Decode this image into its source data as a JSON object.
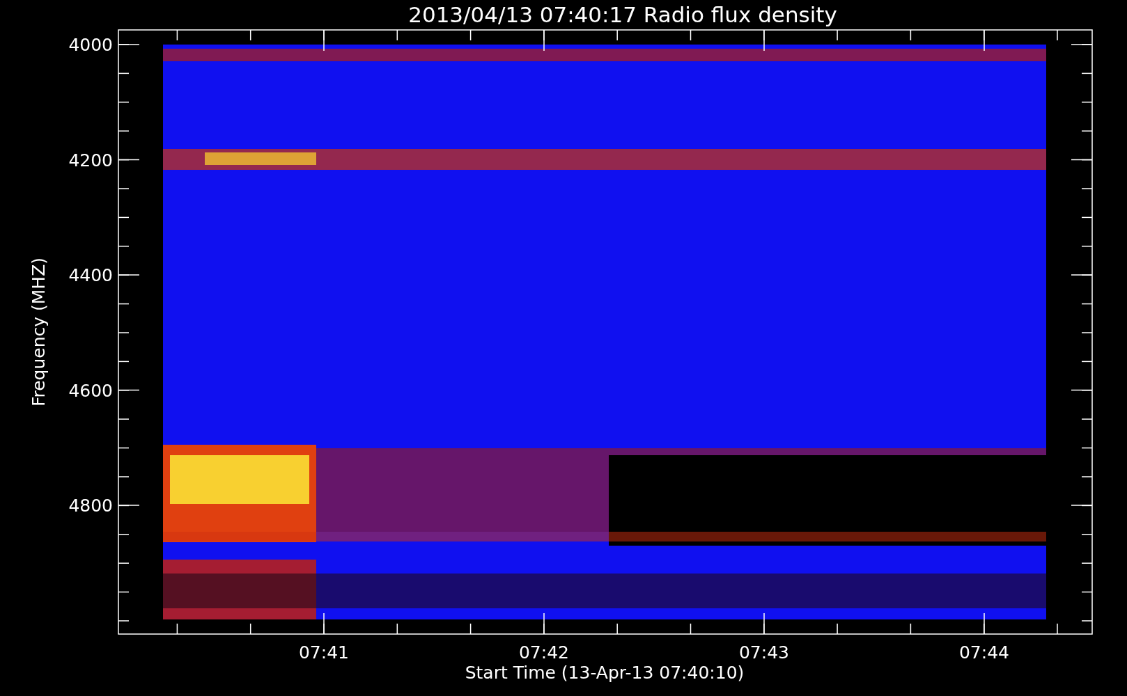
{
  "title": "2013/04/13 07:40:17 Radio flux density",
  "y_axis": {
    "label": "Frequency (MHZ)",
    "ticks": [
      "4000",
      "4200",
      "4400",
      "4600",
      "4800"
    ]
  },
  "x_axis": {
    "label": "Start Time (13-Apr-13 07:40:10)",
    "ticks": [
      "07:41",
      "07:42",
      "07:43",
      "07:44"
    ]
  }
}
